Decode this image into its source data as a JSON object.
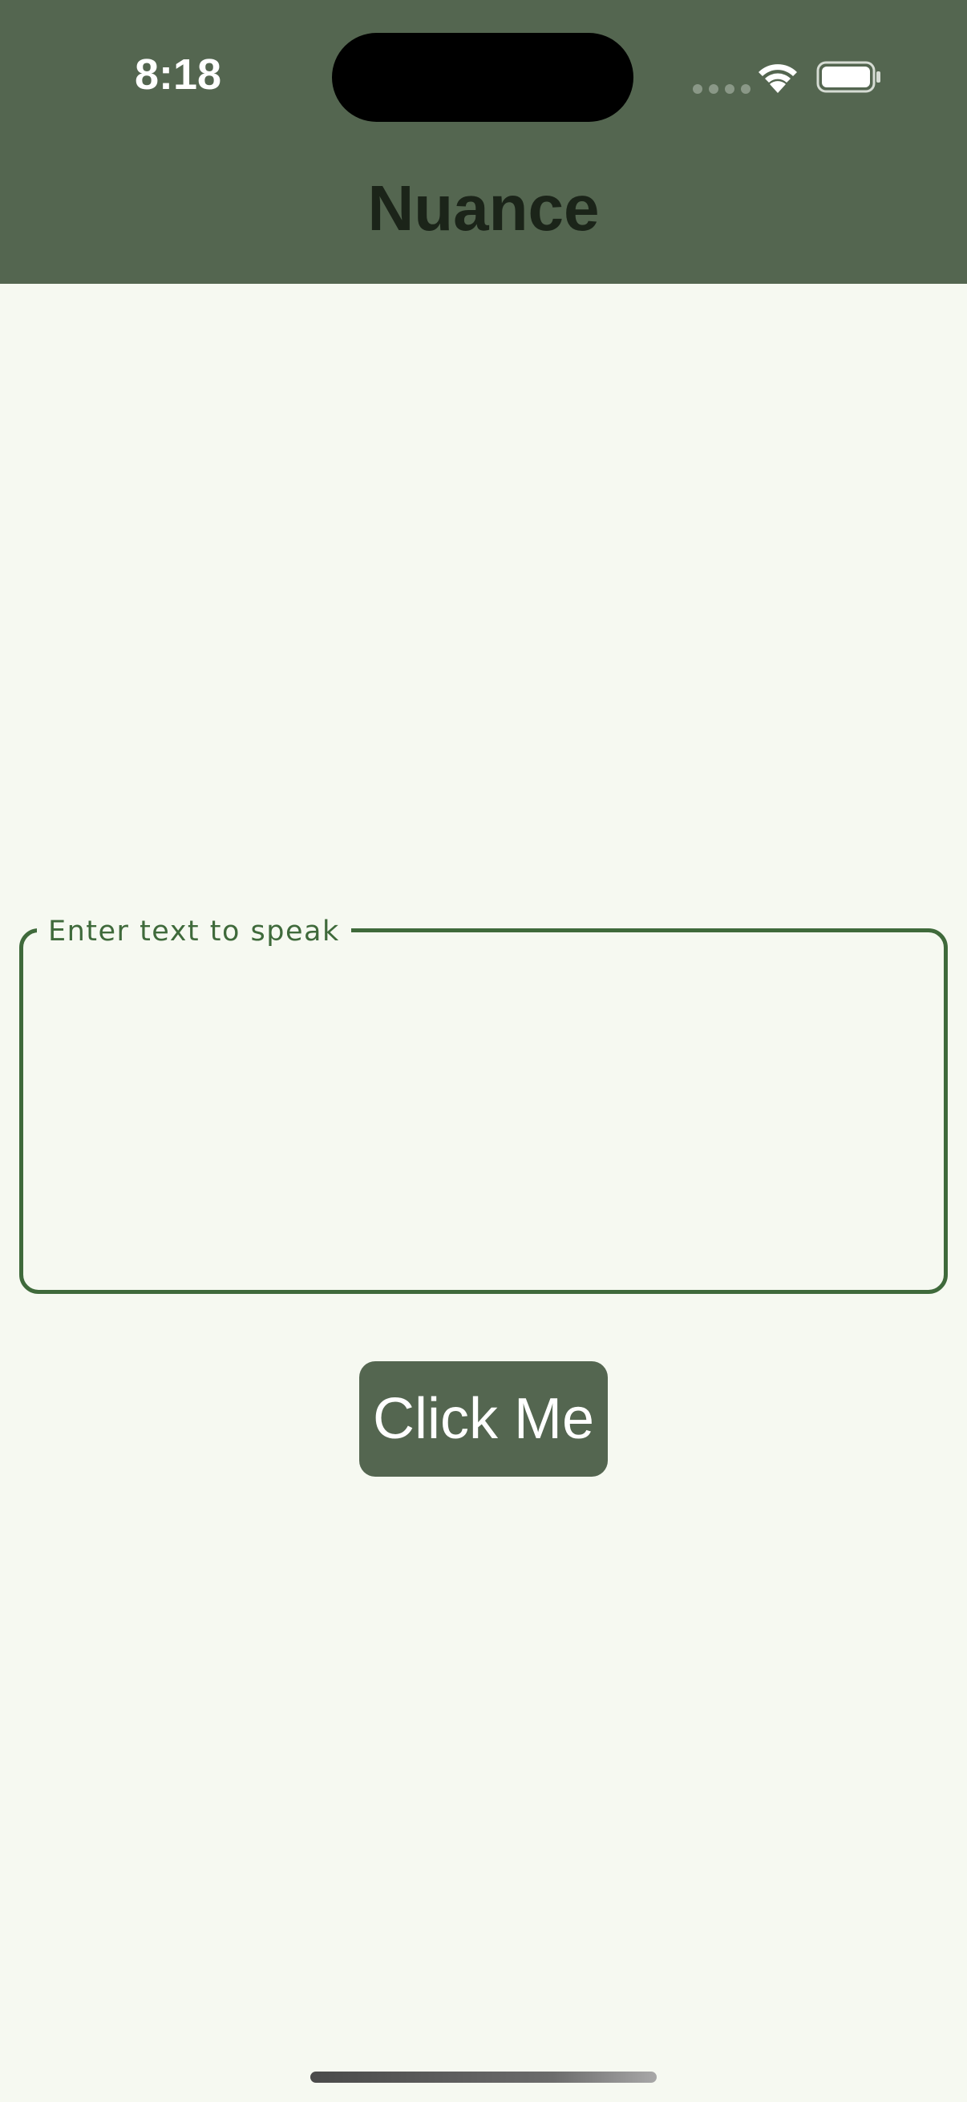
{
  "status_bar": {
    "time": "8:18"
  },
  "app_bar": {
    "title": "Nuance"
  },
  "text_input": {
    "label": "Enter text to speak",
    "value": ""
  },
  "button": {
    "label": "Click Me"
  },
  "colors": {
    "app_bar": "#546650",
    "background": "#f6f9f1",
    "field_border": "#3f6a3b",
    "title_text": "#1b2419",
    "button": "#546650"
  },
  "icons": [
    "signal-icon",
    "wifi-icon",
    "battery-icon"
  ]
}
